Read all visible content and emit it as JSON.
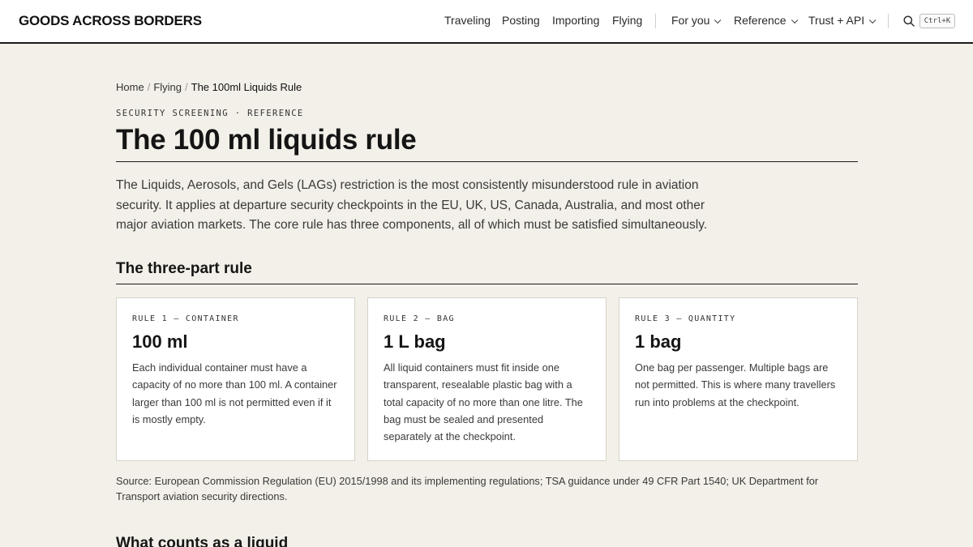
{
  "header": {
    "logo": "GOODS ACROSS BORDERS",
    "nav": {
      "traveling": "Traveling",
      "posting": "Posting",
      "importing": "Importing",
      "flying": "Flying",
      "for_you": "For you",
      "reference": "Reference",
      "trust_api": "Trust + API"
    },
    "search_icon": "search-icon",
    "shortcut": "Ctrl+K"
  },
  "breadcrumb": {
    "home": "Home",
    "flying": "Flying",
    "current": "The 100ml Liquids Rule"
  },
  "eyebrow": "SECURITY SCREENING · REFERENCE",
  "title": "The 100 ml liquids rule",
  "intro": "The Liquids, Aerosols, and Gels (LAGs) restriction is the most consistently misunderstood rule in aviation security. It applies at departure security checkpoints in the EU, UK, US, Canada, Australia, and most other major aviation markets. The core rule has three components, all of which must be satisfied simultaneously.",
  "section_title": "The three-part rule",
  "rules": [
    {
      "label": "RULE 1 — CONTAINER",
      "value": "100 ml",
      "text": "Each individual container must have a capacity of no more than 100 ml. A container larger than 100 ml is not permitted even if it is mostly empty."
    },
    {
      "label": "RULE 2 — BAG",
      "value": "1 L bag",
      "text": "All liquid containers must fit inside one transparent, resealable plastic bag with a total capacity of no more than one litre. The bag must be sealed and presented separately at the checkpoint."
    },
    {
      "label": "RULE 3 — QUANTITY",
      "value": "1 bag",
      "text": "One bag per passenger. Multiple bags are not permitted. This is where many travellers run into problems at the checkpoint."
    }
  ],
  "source": "Source: European Commission Regulation (EU) 2015/1998 and its implementing regulations; TSA guidance under 49 CFR Part 1540; UK Department for Transport aviation security directions.",
  "next_heading": "What counts as a liquid"
}
